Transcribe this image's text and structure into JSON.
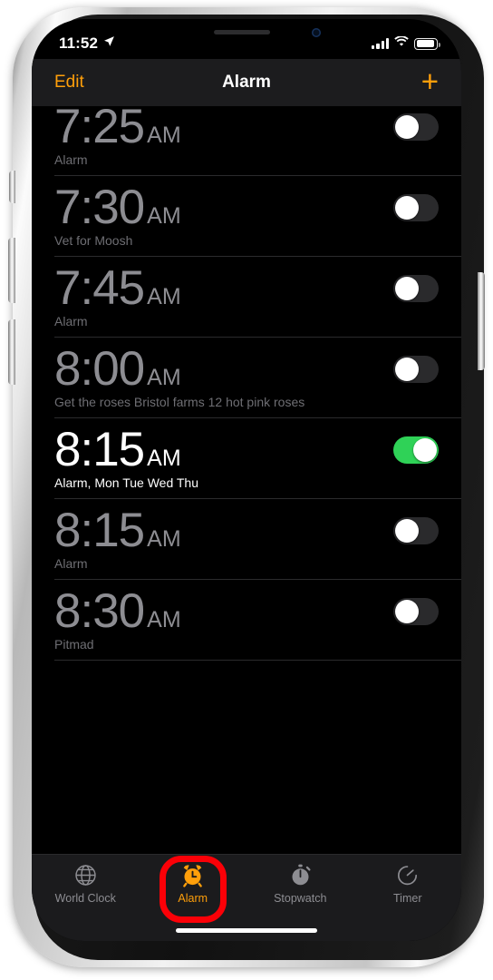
{
  "device": {
    "name": "iphone-with-notch",
    "frame_color": "#f2f2f2"
  },
  "status_bar": {
    "time": "11:52",
    "location_icon": "location-arrow-icon",
    "cellular_icon": "cellular-signal-icon",
    "wifi_icon": "wifi-icon",
    "battery_icon": "battery-icon"
  },
  "nav_bar": {
    "edit_label": "Edit",
    "title": "Alarm",
    "add_label": "+",
    "accent_color": "#ff9f0a"
  },
  "alarms": [
    {
      "time": "7:25",
      "ampm": "AM",
      "label": "Alarm",
      "enabled": false
    },
    {
      "time": "7:30",
      "ampm": "AM",
      "label": "Vet for Moosh",
      "enabled": false
    },
    {
      "time": "7:45",
      "ampm": "AM",
      "label": "Alarm",
      "enabled": false
    },
    {
      "time": "8:00",
      "ampm": "AM",
      "label": "Get the roses Bristol farms 12 hot pink roses",
      "enabled": false
    },
    {
      "time": "8:15",
      "ampm": "AM",
      "label": "Alarm, Mon Tue Wed Thu",
      "enabled": true
    },
    {
      "time": "8:15",
      "ampm": "AM",
      "label": "Alarm",
      "enabled": false
    },
    {
      "time": "8:30",
      "ampm": "AM",
      "label": "Pitmad",
      "enabled": false
    }
  ],
  "toggle_colors": {
    "on": "#2fd257",
    "off": "#2a2a2c",
    "knob": "#ffffff"
  },
  "tab_bar": {
    "items": [
      {
        "label": "World Clock",
        "icon": "globe-icon",
        "active": false
      },
      {
        "label": "Alarm",
        "icon": "alarm-clock-icon",
        "active": true
      },
      {
        "label": "Stopwatch",
        "icon": "stopwatch-icon",
        "active": false
      },
      {
        "label": "Timer",
        "icon": "timer-icon",
        "active": false
      }
    ],
    "active_color": "#ff9f0a",
    "inactive_color": "#8d8d92"
  },
  "annotation": {
    "shape": "rounded-rect-outline",
    "color": "#fb0007",
    "target": "Alarm"
  }
}
